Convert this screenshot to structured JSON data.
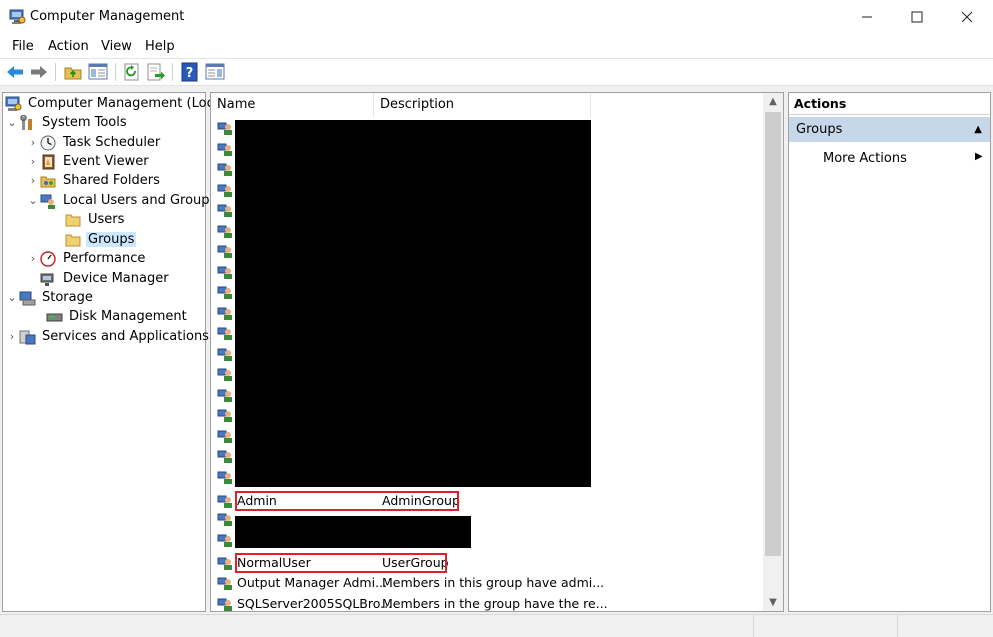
{
  "window": {
    "title": "Computer Management"
  },
  "menu": [
    "File",
    "Action",
    "View",
    "Help"
  ],
  "toolbar": [
    "back-icon",
    "forward-icon",
    "up-folder-icon",
    "show-hide-tree-icon",
    "refresh-icon",
    "export-list-icon",
    "help-icon",
    "show-hide-action-pane-icon"
  ],
  "tree": [
    {
      "label": "Computer Management (Local)",
      "icon": "computer-management-icon"
    },
    {
      "label": "System Tools",
      "icon": "system-tools-icon",
      "expanded": true
    },
    {
      "label": "Task Scheduler",
      "icon": "task-scheduler-icon"
    },
    {
      "label": "Event Viewer",
      "icon": "event-viewer-icon"
    },
    {
      "label": "Shared Folders",
      "icon": "shared-folders-icon"
    },
    {
      "label": "Local Users and Groups",
      "icon": "local-users-groups-icon",
      "expanded": true
    },
    {
      "label": "Users",
      "icon": "folder-icon"
    },
    {
      "label": "Groups",
      "icon": "folder-icon",
      "selected": true
    },
    {
      "label": "Performance",
      "icon": "performance-icon"
    },
    {
      "label": "Device Manager",
      "icon": "device-manager-icon"
    },
    {
      "label": "Storage",
      "icon": "storage-icon",
      "expanded": true
    },
    {
      "label": "Disk Management",
      "icon": "disk-management-icon"
    },
    {
      "label": "Services and Applications",
      "icon": "services-applications-icon"
    }
  ],
  "list": {
    "columns": [
      "Name",
      "Description"
    ],
    "rows": [
      {
        "name": "Admin",
        "description": "AdminGroup"
      },
      {
        "name": "NormalUser",
        "description": "UserGroup"
      },
      {
        "name": "Output Manager Admi...",
        "description": "Members in this group have admi..."
      },
      {
        "name": "SQLServer2005SQLBro...",
        "description": "Members in the group have the re..."
      }
    ]
  },
  "actions": {
    "header": "Actions",
    "group": "Groups",
    "more": "More Actions"
  },
  "colors": {
    "selection": "#cce8ff",
    "action_group": "#c6d7ea",
    "highlight": "#e0202e",
    "redaction": "#000000"
  }
}
